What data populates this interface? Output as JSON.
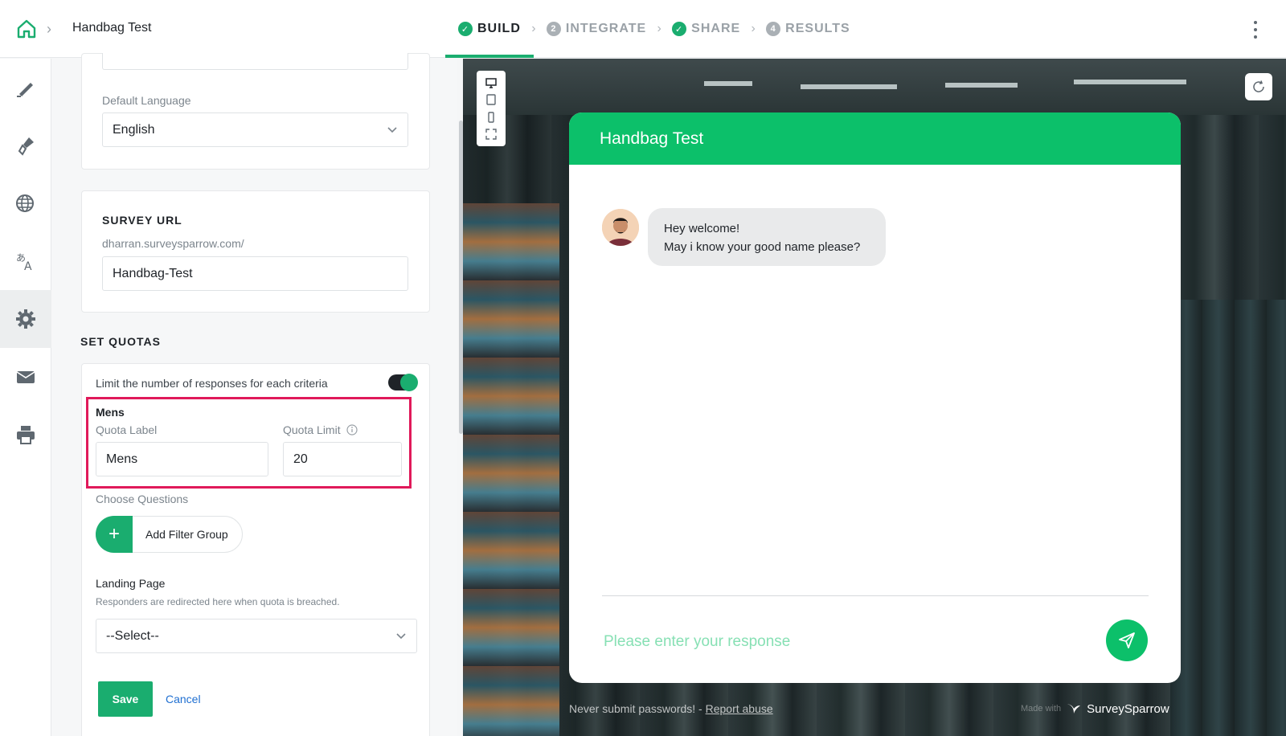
{
  "header": {
    "survey_title": "Handbag Test",
    "steps": [
      {
        "label": "BUILD",
        "state": "done",
        "num": ""
      },
      {
        "label": "INTEGRATE",
        "state": "pending",
        "num": "2"
      },
      {
        "label": "SHARE",
        "state": "done",
        "num": ""
      },
      {
        "label": "RESULTS",
        "state": "pending",
        "num": "4"
      }
    ]
  },
  "rail": {
    "items": [
      "design-icon",
      "theme-brush-icon",
      "globe-icon",
      "translate-icon",
      "gear-icon",
      "mail-icon",
      "print-icon"
    ],
    "active": "gear-icon"
  },
  "panel": {
    "default_language_label": "Default Language",
    "default_language_value": "English",
    "survey_url_title": "SURVEY URL",
    "survey_url_prefix": "dharran.surveysparrow.com/",
    "survey_url_value": "Handbag-Test",
    "set_quotas_title": "SET QUOTAS",
    "limit_text": "Limit the number of responses for each criteria",
    "quota_name": "Mens",
    "quota_label_label": "Quota Label",
    "quota_label_value": "Mens",
    "quota_limit_label": "Quota Limit",
    "quota_limit_value": "20",
    "choose_questions": "Choose Questions",
    "add_filter_group": "Add Filter Group",
    "landing_page_label": "Landing Page",
    "landing_page_help": "Responders are redirected here when quota is breached.",
    "landing_page_value": "--Select--",
    "save": "Save",
    "cancel": "Cancel"
  },
  "preview": {
    "chat_title": "Handbag Test",
    "bubble_line1": "Hey welcome!",
    "bubble_line2": "May i know your good name please?",
    "input_placeholder": "Please enter your response",
    "footer_text": "Never submit passwords! - ",
    "footer_link": "Report abuse",
    "brand_made": "Made with",
    "brand_name": "SurveySparrow"
  },
  "colors": {
    "accent": "#1aad6f",
    "chat_green": "#0cc06a",
    "highlight": "#e0195a"
  }
}
